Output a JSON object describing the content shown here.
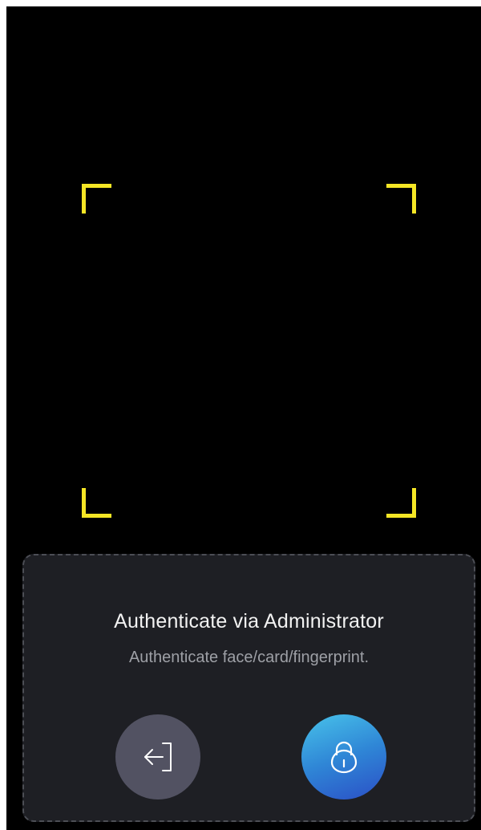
{
  "scanner": {
    "frame_color": "#f5e625"
  },
  "auth_panel": {
    "title": "Authenticate via Administrator",
    "subtitle": "Authenticate face/card/fingerprint.",
    "exit_button": {
      "icon": "exit-icon",
      "color": "#525262"
    },
    "unlock_button": {
      "icon": "lock-icon",
      "gradient": [
        "#48c3ea",
        "#2b4fc6"
      ]
    }
  }
}
